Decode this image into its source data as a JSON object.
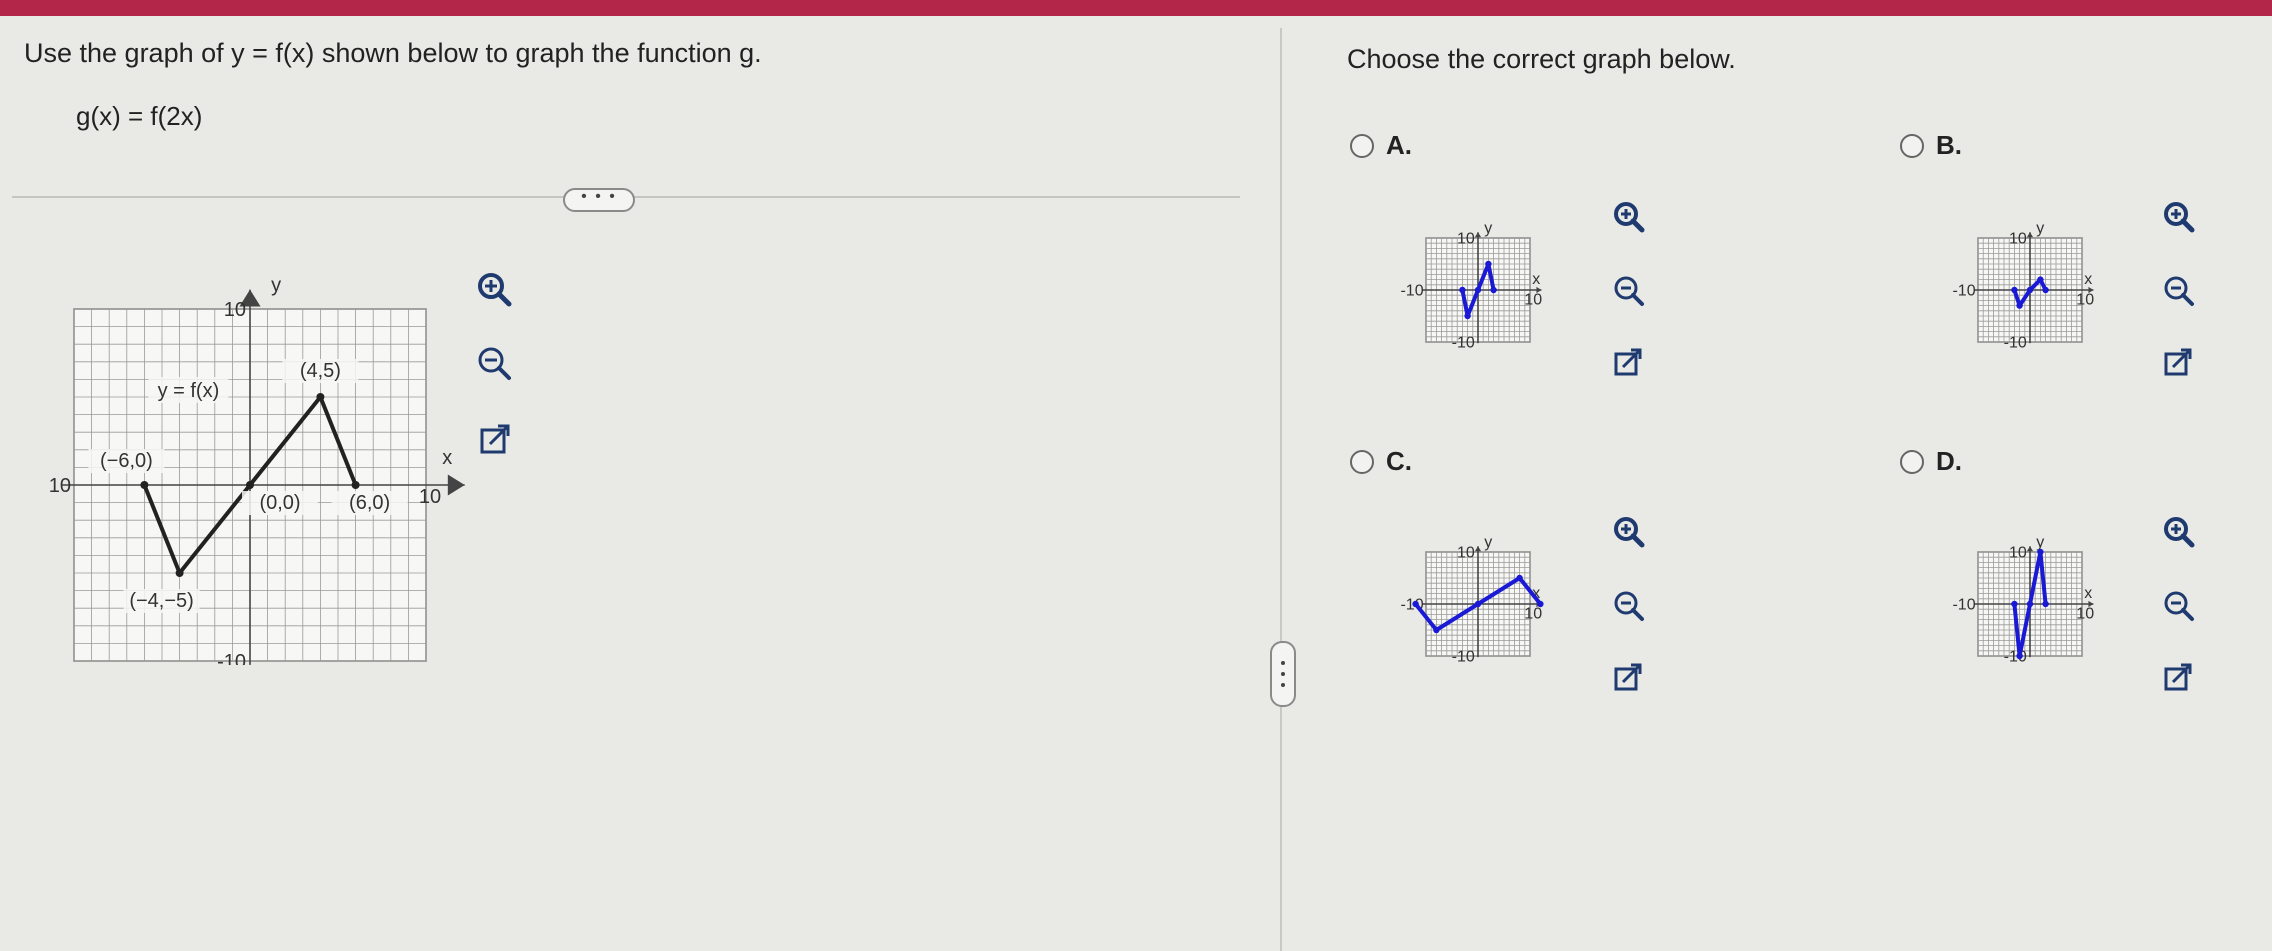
{
  "question": {
    "prompt": "Use the graph of y = f(x) shown below to graph the function g.",
    "function": "g(x) = f(2x)",
    "more_label": "• • •"
  },
  "answer_prompt": "Choose the correct graph below.",
  "main_graph": {
    "axis_x": "x",
    "axis_y": "y",
    "tick_neg": "-10",
    "tick_pos": "10",
    "curve_label": "y = f(x)",
    "points": [
      {
        "x": -6,
        "y": 0,
        "label": "(−6,0)"
      },
      {
        "x": -4,
        "y": -5,
        "label": "(−4,−5)"
      },
      {
        "x": 0,
        "y": 0,
        "label": "(0,0)"
      },
      {
        "x": 4,
        "y": 5,
        "label": "(4,5)"
      },
      {
        "x": 6,
        "y": 0,
        "label": "(6,0)"
      }
    ]
  },
  "options": [
    {
      "letter": "A.",
      "points": [
        [
          -3,
          0
        ],
        [
          -2,
          -5
        ],
        [
          0,
          0
        ],
        [
          2,
          5
        ],
        [
          3,
          0
        ]
      ]
    },
    {
      "letter": "B.",
      "points": [
        [
          -3,
          0
        ],
        [
          -2,
          -3
        ],
        [
          0,
          0
        ],
        [
          2,
          2
        ],
        [
          3,
          0
        ]
      ]
    },
    {
      "letter": "C.",
      "points": [
        [
          -12,
          0
        ],
        [
          -8,
          -5
        ],
        [
          0,
          0
        ],
        [
          8,
          5
        ],
        [
          12,
          0
        ]
      ]
    },
    {
      "letter": "D.",
      "points": [
        [
          -3,
          0
        ],
        [
          -2,
          -10
        ],
        [
          0,
          0
        ],
        [
          2,
          10
        ],
        [
          3,
          0
        ]
      ]
    }
  ],
  "colors": {
    "curve_main": "#222222",
    "curve_option": "#1a1ad6",
    "accent_bar": "#b3264a"
  },
  "icons": [
    "zoom-in-icon",
    "zoom-out-icon",
    "open-external-icon"
  ]
}
